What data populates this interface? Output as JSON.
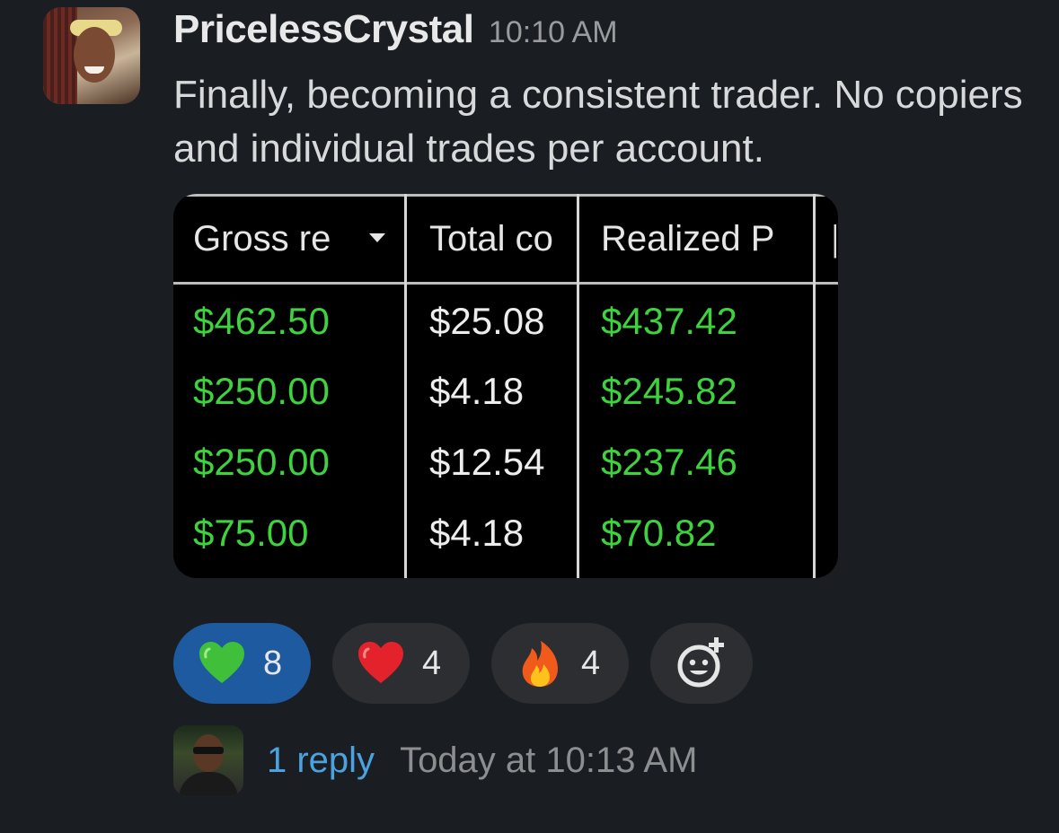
{
  "message": {
    "author": "PricelessCrystal",
    "time": "10:10 AM",
    "text": "Finally, becoming a consistent trader.  No copiers and individual trades per account."
  },
  "attachment": {
    "columns": [
      "Gross re",
      "Total co",
      "Realized P"
    ],
    "rows": [
      [
        "$462.50",
        "$25.08",
        "$437.42"
      ],
      [
        "$250.00",
        "$4.18",
        "$245.82"
      ],
      [
        "$250.00",
        "$12.54",
        "$237.46"
      ],
      [
        "$75.00",
        "$4.18",
        "$70.82"
      ]
    ],
    "colors": {
      "positive": "#3ed23e",
      "neutral": "#ededed"
    }
  },
  "reactions": [
    {
      "emoji": "green-heart",
      "count": "8",
      "selected": true
    },
    {
      "emoji": "red-heart",
      "count": "4",
      "selected": false
    },
    {
      "emoji": "fire",
      "count": "4",
      "selected": false
    }
  ],
  "add_reaction": {
    "icon": "add-reaction-icon"
  },
  "thread": {
    "reply_count": "1 reply",
    "last_reply": "Today at 10:13 AM"
  },
  "theme": {
    "background": "#1a1d21",
    "selected_reaction": "#1d5aa0",
    "link": "#4aa3df"
  }
}
